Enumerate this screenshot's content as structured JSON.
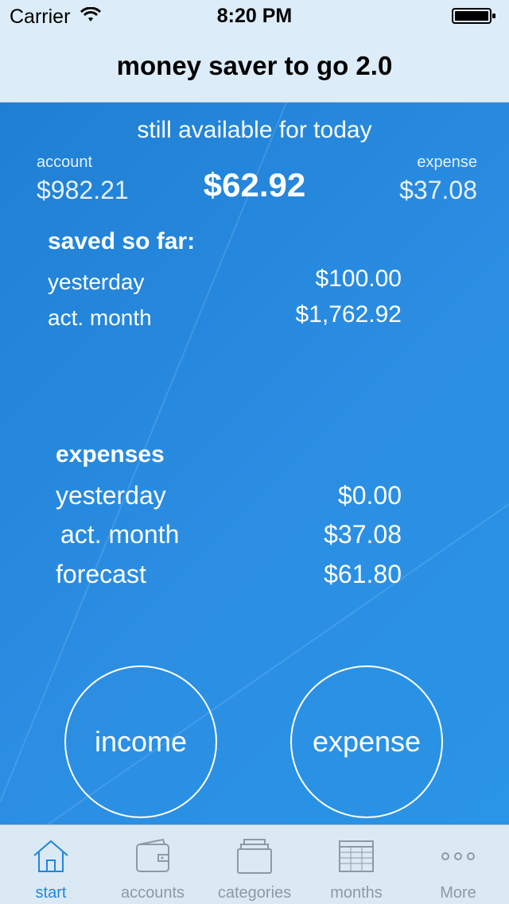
{
  "status": {
    "carrier": "Carrier",
    "time": "8:20 PM"
  },
  "nav": {
    "title": "money saver to go 2.0"
  },
  "summary": {
    "title": "still available for today",
    "account_label": "account",
    "account_value": "$982.21",
    "today_value": "$62.92",
    "expense_label": "expense",
    "expense_value": "$37.08"
  },
  "saved": {
    "heading": "saved so far:",
    "rows": [
      {
        "label": "yesterday",
        "value": "$100.00"
      },
      {
        "label": "act. month",
        "value": "$1,762.92"
      }
    ]
  },
  "expenses": {
    "heading": "expenses",
    "rows": [
      {
        "label": "yesterday",
        "value": "$0.00"
      },
      {
        "label": "act. month",
        "value": "$37.08"
      },
      {
        "label": "forecast",
        "value": "$61.80"
      }
    ]
  },
  "buttons": {
    "income": "income",
    "expense": "expense"
  },
  "tabs": [
    {
      "label": "start",
      "icon": "house-icon",
      "active": true
    },
    {
      "label": "accounts",
      "icon": "wallet-icon",
      "active": false
    },
    {
      "label": "categories",
      "icon": "folders-icon",
      "active": false
    },
    {
      "label": "months",
      "icon": "table-icon",
      "active": false
    },
    {
      "label": "More",
      "icon": "more-dots-icon",
      "active": false
    }
  ],
  "colors": {
    "accent": "#1d86e1",
    "background_blue": "#2a8ad6",
    "tab_inactive": "#8d9aa6"
  }
}
